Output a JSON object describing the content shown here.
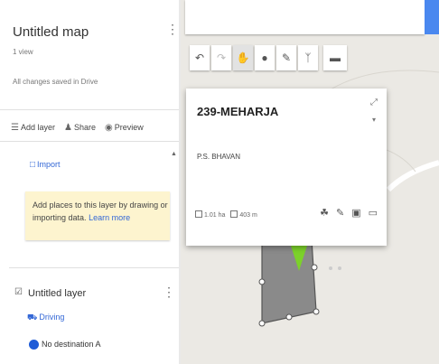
{
  "map_title": "Untitled map",
  "map_views": "1 view",
  "save_status": "All changes saved in Drive",
  "panel_actions": [
    {
      "icon": "add-layer-icon",
      "label": "Add layer"
    },
    {
      "icon": "share-icon",
      "label": "Share"
    },
    {
      "icon": "preview-icon",
      "label": "Preview"
    }
  ],
  "import_link": "Import",
  "hint": {
    "text": "Add places to this layer by drawing or importing data.",
    "link": "Learn more"
  },
  "layer": {
    "name": "Untitled layer",
    "mode": "Driving",
    "destination": "No destination A"
  },
  "toolbar_icons": [
    "undo-icon",
    "redo-icon",
    "hand-icon",
    "marker-icon",
    "draw-line-icon",
    "directions-icon",
    "ruler-icon"
  ],
  "card": {
    "title": "239-MEHARJA",
    "description": "P.S. BHAVAN",
    "area": "1.01 ha",
    "perimeter": "403 m"
  },
  "colors": {
    "accent": "#4a88ef",
    "link": "#3367d6",
    "hint_bg": "#fdf4cf",
    "polygon_fill": "#8a8a8a",
    "marker": "#7cd12a"
  }
}
